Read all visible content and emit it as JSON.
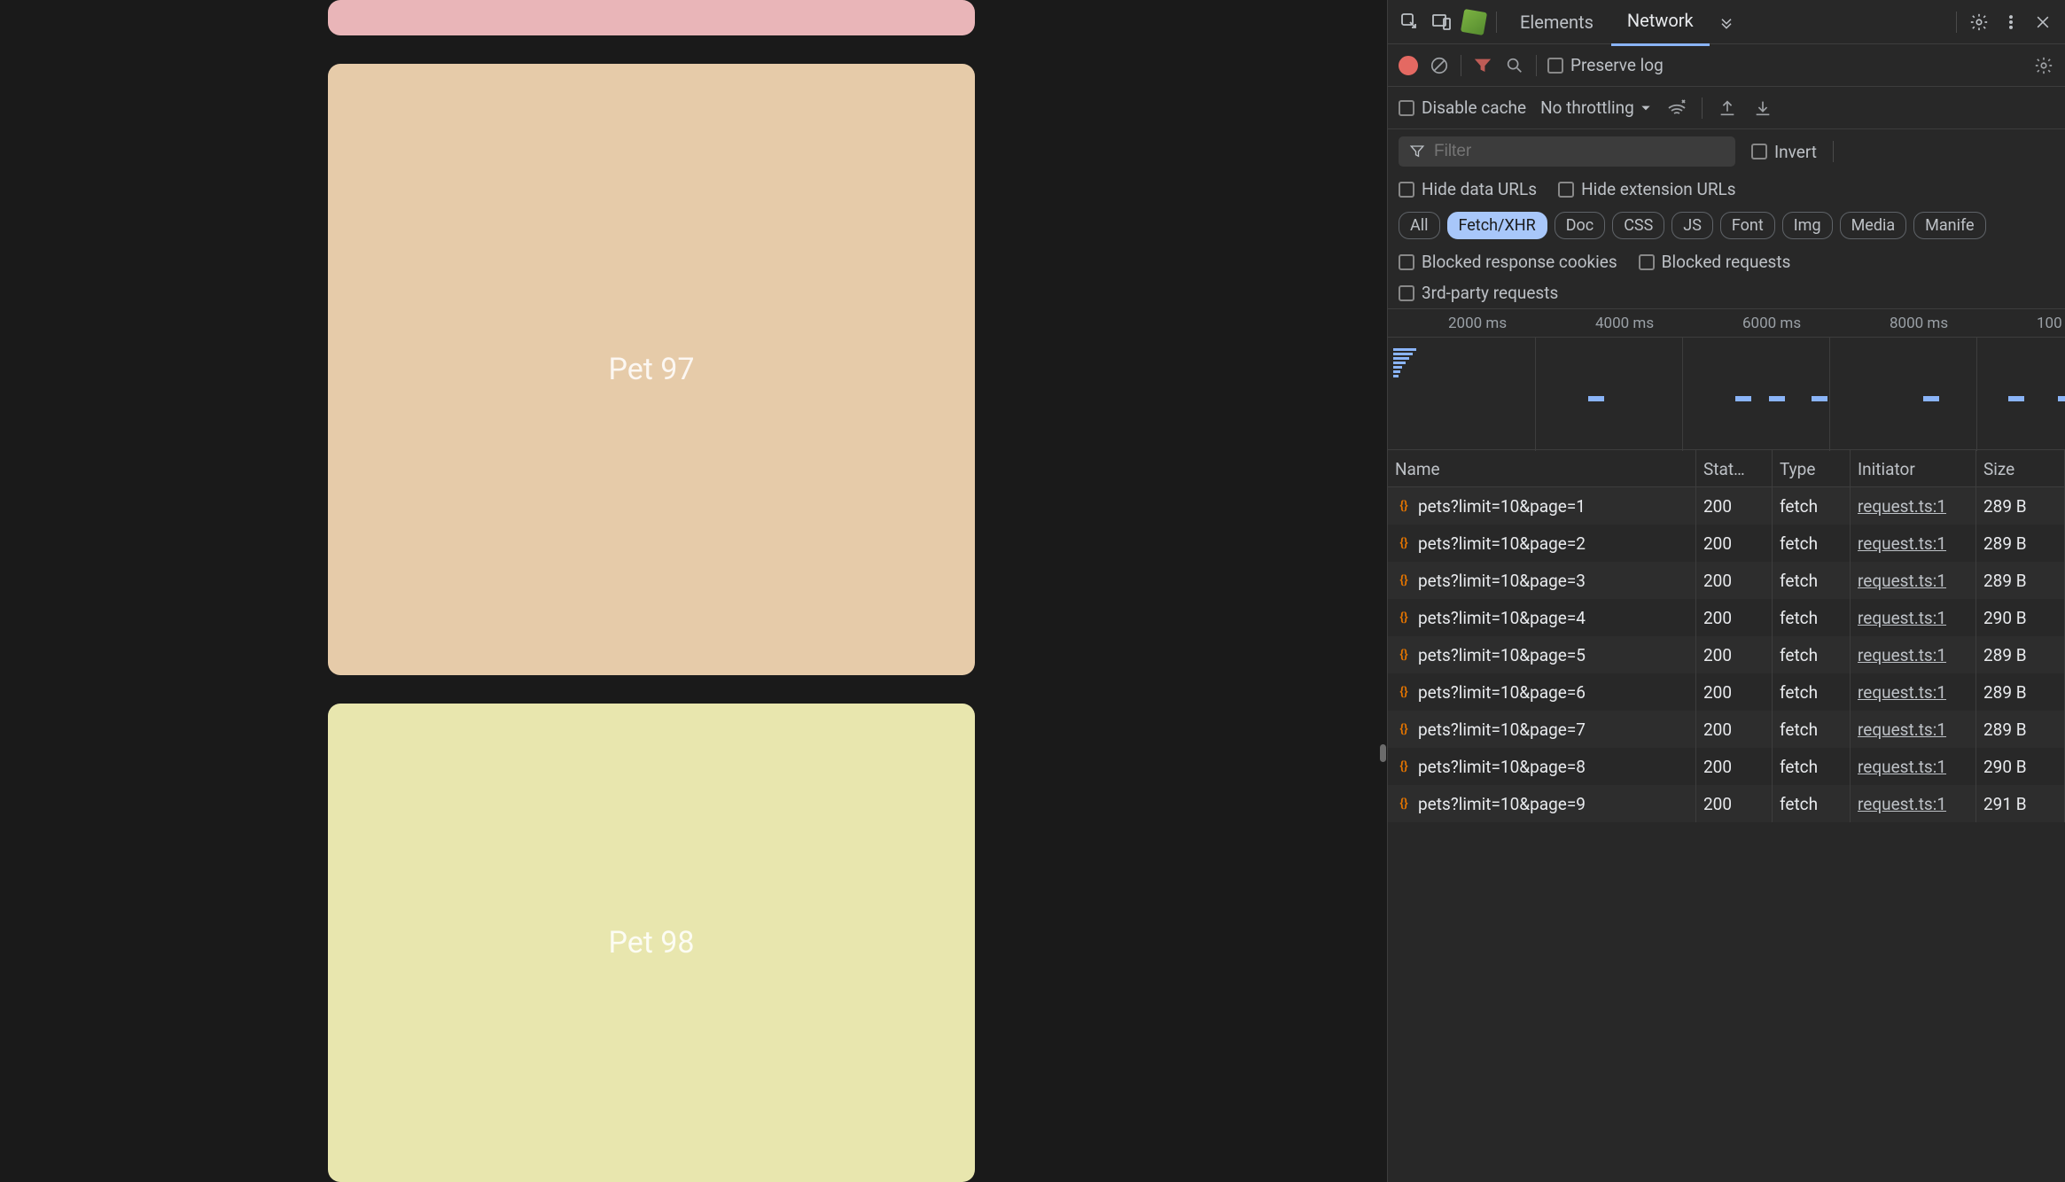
{
  "left": {
    "cards": [
      {
        "label": "",
        "color": "pink"
      },
      {
        "label": "Pet 97",
        "color": "tan"
      },
      {
        "label": "Pet 98",
        "color": "yellow"
      }
    ]
  },
  "tabs": {
    "elements": "Elements",
    "network": "Network"
  },
  "controls": {
    "preserve_log": "Preserve log",
    "disable_cache": "Disable cache",
    "throttling": "No throttling",
    "filter_placeholder": "Filter",
    "invert": "Invert",
    "hide_data_urls": "Hide data URLs",
    "hide_ext_urls": "Hide extension URLs",
    "blocked_resp": "Blocked response cookies",
    "blocked_req": "Blocked requests",
    "third_party": "3rd-party requests"
  },
  "pills": {
    "all": "All",
    "fetchxhr": "Fetch/XHR",
    "doc": "Doc",
    "css": "CSS",
    "js": "JS",
    "font": "Font",
    "img": "Img",
    "media": "Media",
    "manifest": "Manife"
  },
  "timeline": {
    "labels": [
      "2000 ms",
      "4000 ms",
      "6000 ms",
      "8000 ms",
      "100"
    ]
  },
  "table": {
    "headers": {
      "name": "Name",
      "status": "Stat…",
      "type": "Type",
      "initiator": "Initiator",
      "size": "Size"
    },
    "rows": [
      {
        "name": "pets?limit=10&page=1",
        "status": "200",
        "type": "fetch",
        "initiator": "request.ts:1",
        "size": "289 B"
      },
      {
        "name": "pets?limit=10&page=2",
        "status": "200",
        "type": "fetch",
        "initiator": "request.ts:1",
        "size": "289 B"
      },
      {
        "name": "pets?limit=10&page=3",
        "status": "200",
        "type": "fetch",
        "initiator": "request.ts:1",
        "size": "289 B"
      },
      {
        "name": "pets?limit=10&page=4",
        "status": "200",
        "type": "fetch",
        "initiator": "request.ts:1",
        "size": "290 B"
      },
      {
        "name": "pets?limit=10&page=5",
        "status": "200",
        "type": "fetch",
        "initiator": "request.ts:1",
        "size": "289 B"
      },
      {
        "name": "pets?limit=10&page=6",
        "status": "200",
        "type": "fetch",
        "initiator": "request.ts:1",
        "size": "289 B"
      },
      {
        "name": "pets?limit=10&page=7",
        "status": "200",
        "type": "fetch",
        "initiator": "request.ts:1",
        "size": "289 B"
      },
      {
        "name": "pets?limit=10&page=8",
        "status": "200",
        "type": "fetch",
        "initiator": "request.ts:1",
        "size": "290 B"
      },
      {
        "name": "pets?limit=10&page=9",
        "status": "200",
        "type": "fetch",
        "initiator": "request.ts:1",
        "size": "291 B"
      }
    ]
  }
}
